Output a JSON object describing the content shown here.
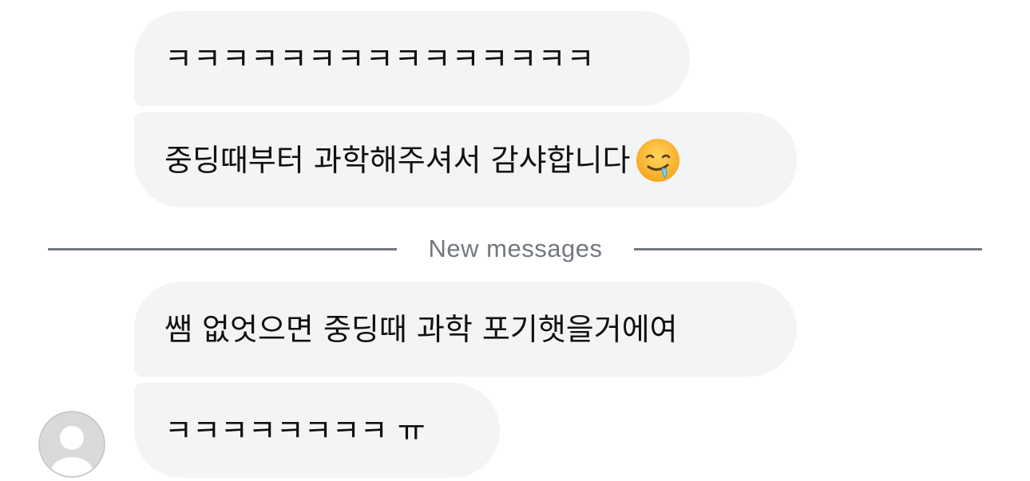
{
  "messages": [
    {
      "text": "ㅋㅋㅋㅋㅋㅋㅋㅋㅋㅋㅋㅋㅋㅋㅋ"
    },
    {
      "text": "중딩때부터 과학해주셔서 감샤합니다",
      "emoji": "drooling-face-icon"
    },
    {
      "text": "쌤 없엇으면 중딩때 과학 포기햇을거에여"
    },
    {
      "text": "ㅋㅋㅋㅋㅋㅋㅋㅋ ㅠ"
    }
  ],
  "divider": {
    "label": "New messages"
  },
  "avatar": {
    "icon": "default-avatar-icon"
  },
  "colors": {
    "bubble_bg": "#f3f4f6",
    "text": "#111111",
    "divider": "#737880"
  }
}
